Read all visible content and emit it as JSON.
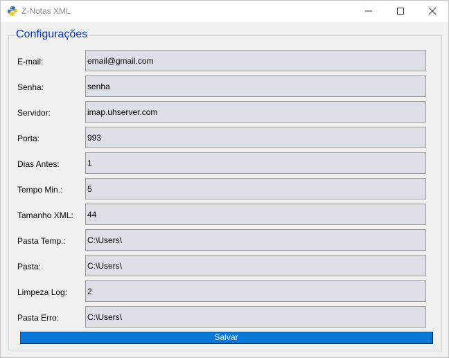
{
  "window": {
    "title": "Z-Notas XML",
    "app_icon": "python-icon",
    "controls": [
      "minimize-icon",
      "maximize-icon",
      "close-icon"
    ]
  },
  "group": {
    "title": "Configurações"
  },
  "fields": [
    {
      "id": "email",
      "label": "E-mail:",
      "value": "email@gmail.com"
    },
    {
      "id": "senha",
      "label": "Senha:",
      "value": "senha"
    },
    {
      "id": "servidor",
      "label": "Servidor:",
      "value": "imap.uhserver.com"
    },
    {
      "id": "porta",
      "label": "Porta:",
      "value": "993"
    },
    {
      "id": "dias-antes",
      "label": "Dias Antes:",
      "value": "1"
    },
    {
      "id": "tempo-min",
      "label": "Tempo Min.:",
      "value": "5"
    },
    {
      "id": "tamanho-xml",
      "label": "Tamanho XML:",
      "value": "44"
    },
    {
      "id": "pasta-temp",
      "label": "Pasta Temp.:",
      "value": "C:\\Users\\"
    },
    {
      "id": "pasta",
      "label": "Pasta:",
      "value": "C:\\Users\\"
    },
    {
      "id": "limpeza-log",
      "label": "Limpeza Log:",
      "value": "2"
    },
    {
      "id": "pasta-erro",
      "label": "Pasta Erro:",
      "value": "C:\\Users\\"
    }
  ],
  "actions": {
    "save_label": "Salvar"
  },
  "colors": {
    "accent": "#0a78d7",
    "group_title": "#0033cc",
    "input_bg": "#dcdfe6"
  }
}
